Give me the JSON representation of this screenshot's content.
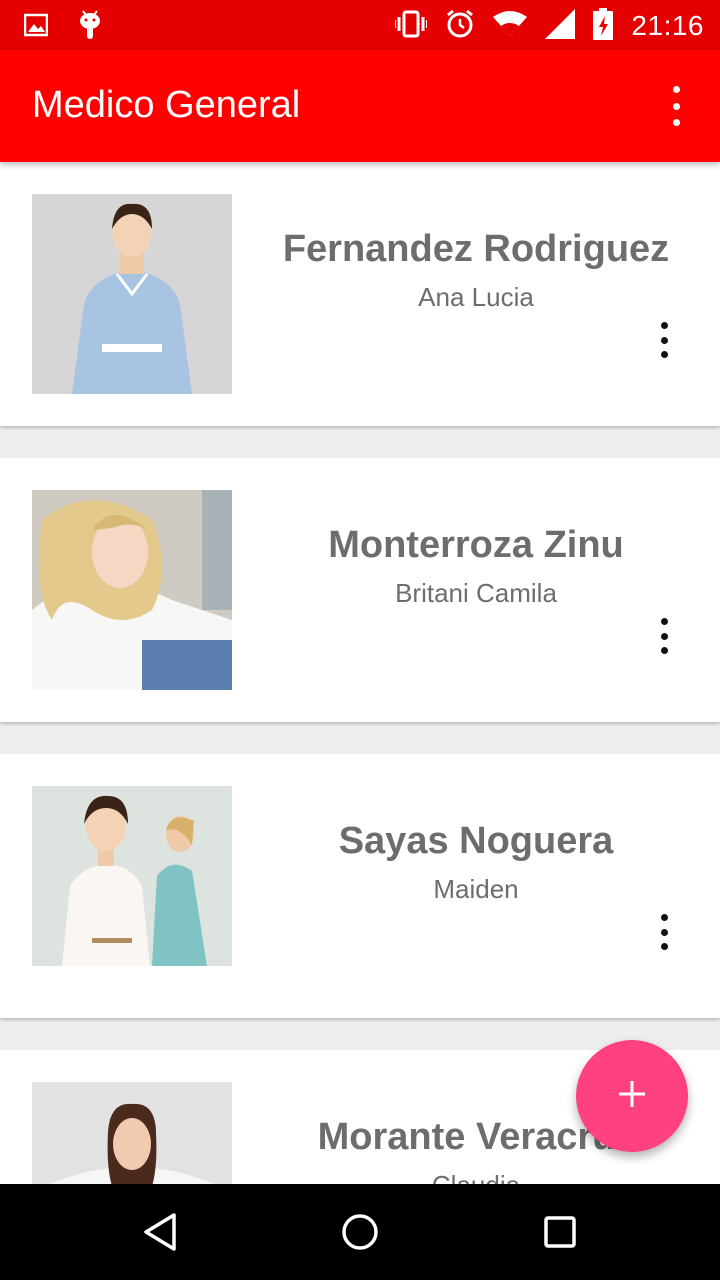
{
  "status_bar": {
    "time": "21:16",
    "left_icons": [
      "image-icon",
      "android-debug-icon"
    ],
    "right_icons": [
      "vibrate-icon",
      "alarm-icon",
      "wifi-icon",
      "signal-icon",
      "battery-charging-icon"
    ]
  },
  "app_bar": {
    "title": "Medico General",
    "overflow_icon": "more-vert-icon"
  },
  "colors": {
    "app_bar": "#ff0000",
    "status_bar": "#e40000",
    "fab": "#ff4081",
    "name_text": "#6d6d6d"
  },
  "patients": [
    {
      "last_name": "Fernandez Rodriguez",
      "first_name": "Ana Lucia",
      "photo": "nurse-photo"
    },
    {
      "last_name": "Monterroza Zinu",
      "first_name": "Britani Camila",
      "photo": "patient-bed-photo"
    },
    {
      "last_name": "Sayas Noguera",
      "first_name": "Maiden",
      "photo": "hospital-woman-photo"
    },
    {
      "last_name": "Morante Veracruz",
      "first_name": "Claudia",
      "photo": "patient-photo"
    }
  ],
  "fab": {
    "icon": "plus-icon"
  },
  "nav_bar": {
    "icons": [
      "back-icon",
      "home-icon",
      "recents-icon"
    ]
  }
}
